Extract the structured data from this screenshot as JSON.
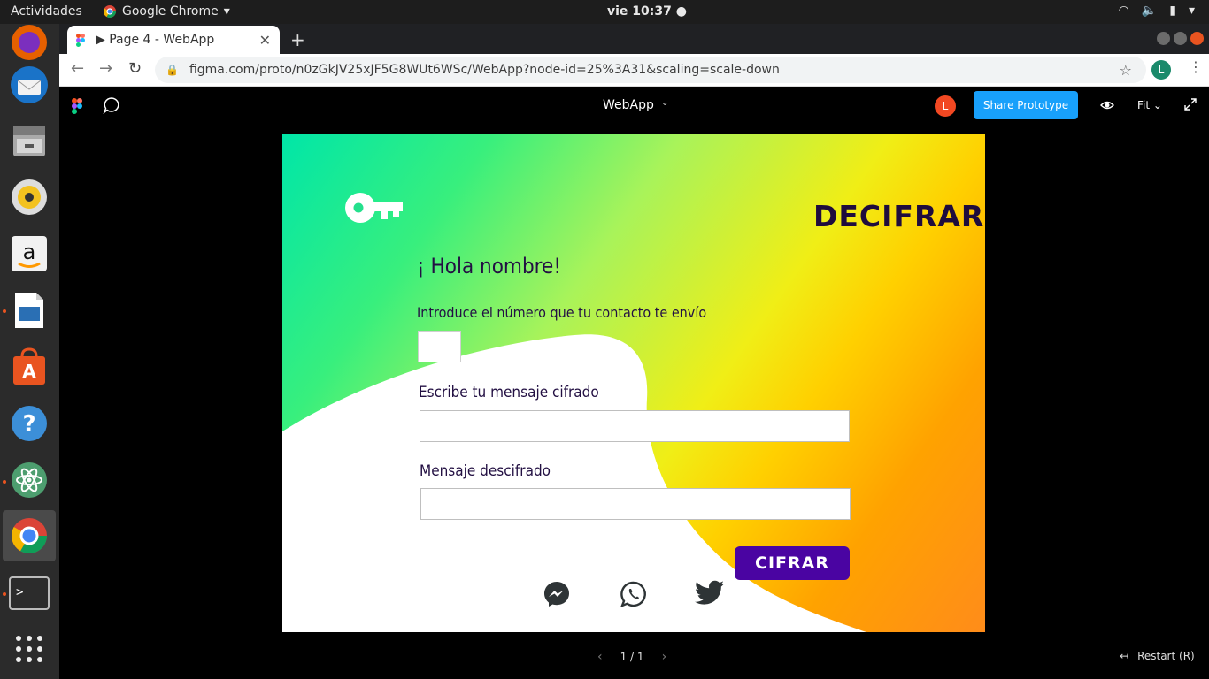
{
  "system_bar": {
    "activities": "Actividades",
    "app_name": "Google Chrome",
    "clock": "vie 10:37"
  },
  "dock": {
    "items": [
      "firefox-icon",
      "thunderbird-icon",
      "files-icon",
      "rhythmbox-icon",
      "amazon-icon",
      "libreoffice-impress-icon",
      "software-center-icon",
      "help-icon",
      "atom-icon",
      "chrome-icon",
      "terminal-icon",
      "apps-grid-icon"
    ]
  },
  "browser": {
    "tab_title": "▶ Page 4 - WebApp",
    "url": "figma.com/proto/n0zGkJV25xJF5G8WUt6WSc/WebApp?node-id=25%3A31&scaling=scale-down",
    "profile_initial": "L"
  },
  "figma": {
    "file_name": "WebApp",
    "user_initial": "L",
    "share_label": "Share Prototype",
    "zoom_label": "Fit",
    "page_indicator": "1 / 1",
    "restart_label": "Restart (R)"
  },
  "frame": {
    "heading": "DECIFRAR",
    "greeting": "¡ Hola nombre!",
    "number_prompt": "Introduce el número que tu contacto te envío",
    "cipher_label": "Escribe tu mensaje cifrado",
    "decoded_label": "Mensaje descifrado",
    "cipher_button": "CIFRAR",
    "social": [
      "messenger-icon",
      "whatsapp-icon",
      "twitter-icon"
    ]
  },
  "colors": {
    "accent_button": "#4a04a2",
    "share_button": "#18a0fb",
    "heading_text": "#1f0c3d"
  }
}
